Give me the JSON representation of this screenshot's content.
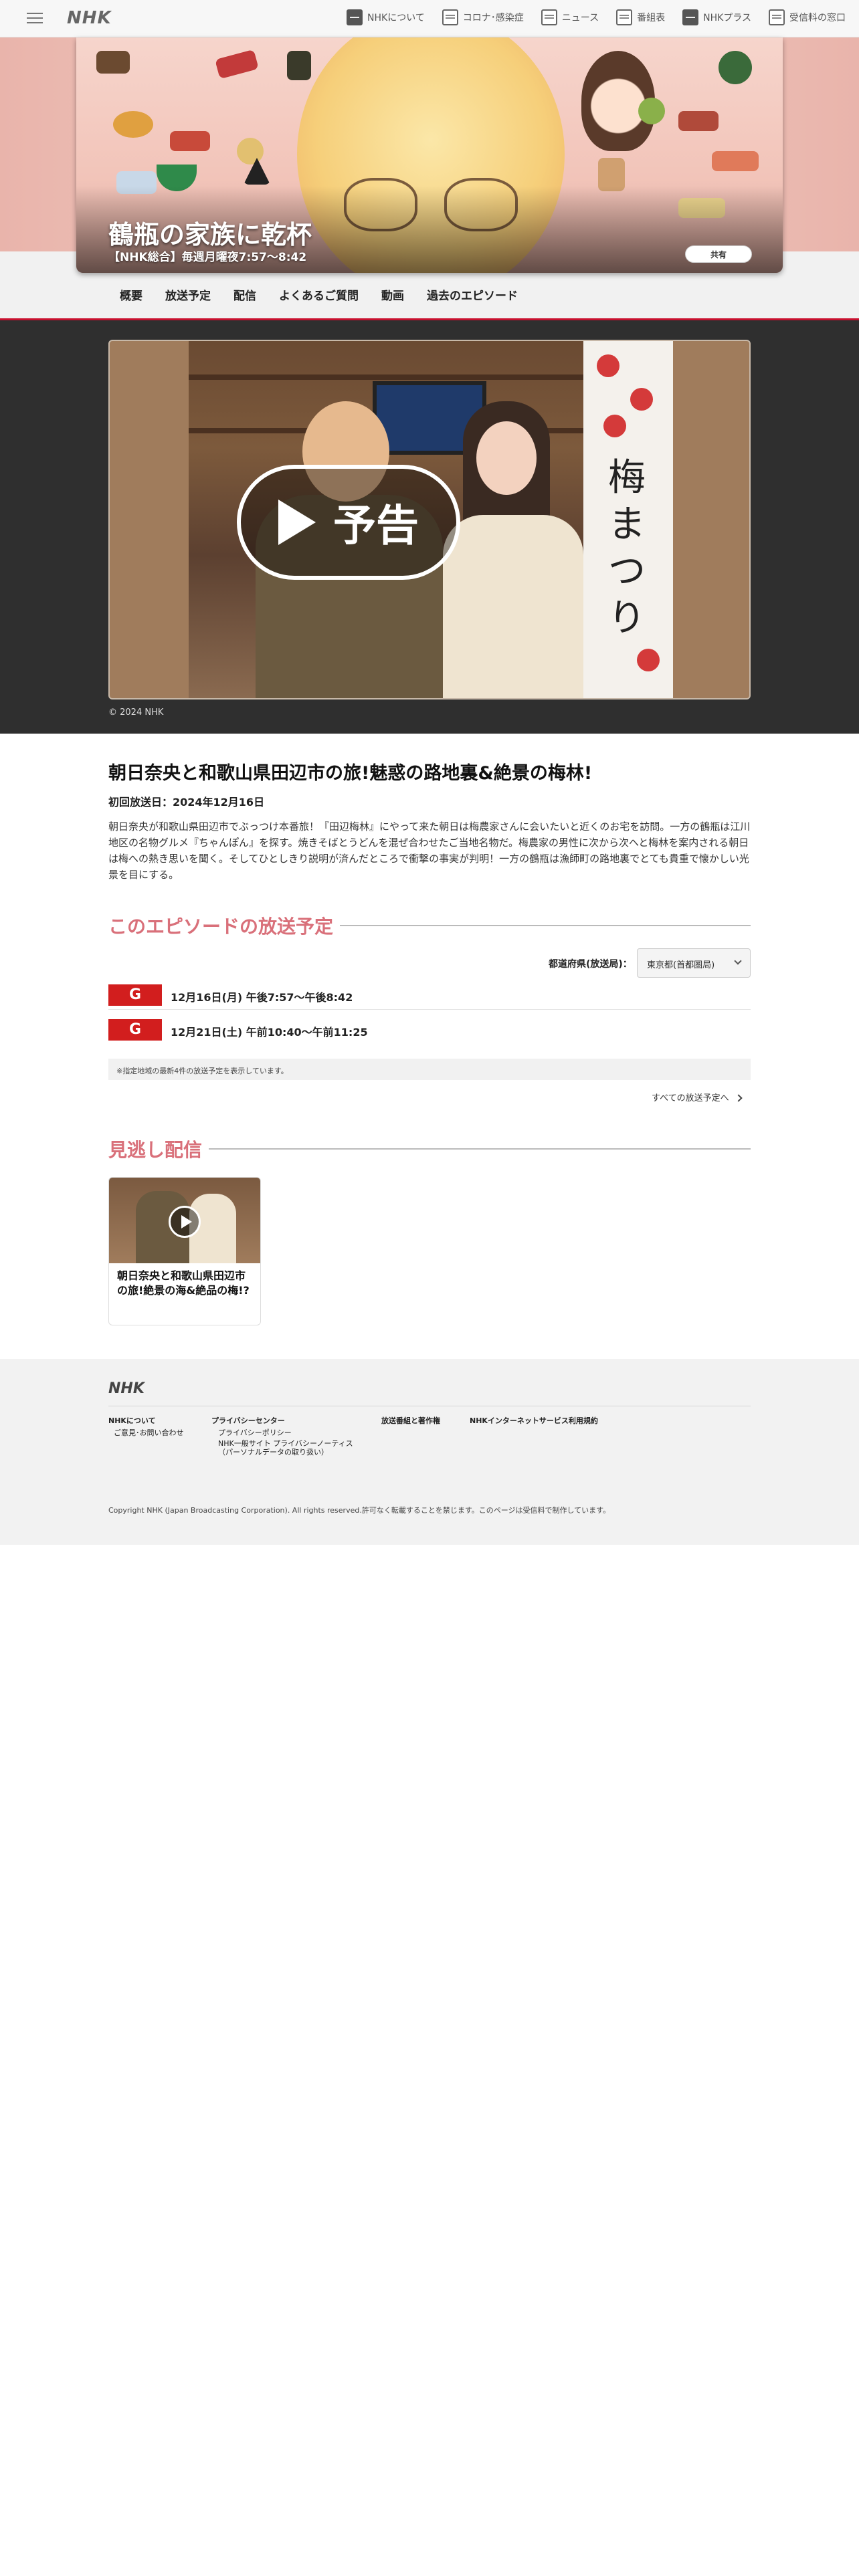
{
  "header": {
    "logo": "NHK",
    "nav": [
      {
        "label": "NHKについて",
        "icon": "nhk-about-icon"
      },
      {
        "label": "コロナ･感染症",
        "icon": "corona-icon"
      },
      {
        "label": "ニュース",
        "icon": "news-icon"
      },
      {
        "label": "番組表",
        "icon": "program-guide-icon"
      },
      {
        "label": "NHKプラス",
        "icon": "nhk-plus-icon"
      },
      {
        "label": "受信料の窓口",
        "icon": "fee-counter-icon"
      }
    ]
  },
  "program": {
    "title": "鶴瓶の家族に乾杯",
    "schedule": "【NHK総合】毎週月曜夜7:57〜8:42",
    "share_label": "共有"
  },
  "tabs": [
    "概要",
    "放送予定",
    "配信",
    "よくあるご質問",
    "動画",
    "過去のエピソード"
  ],
  "player": {
    "play_label": "予告",
    "banner_text": "梅まつり",
    "copyright": "© 2024 NHK"
  },
  "episode": {
    "title": "朝日奈央と和歌山県田辺市の旅!魅惑の路地裏&絶景の梅林!",
    "first_air": "初回放送日：2024年12月16日",
    "description": "朝日奈央が和歌山県田辺市でぶっつけ本番旅！『田辺梅林』にやって来た朝日は梅農家さんに会いたいと近くのお宅を訪問。一方の鶴瓶は江川地区の名物グルメ『ちゃんぽん』を探す。焼きそばとうどんを混ぜ合わせたご当地名物だ。梅農家の男性に次から次へと梅林を案内される朝日は梅への熱き思いを聞く。そしてひとしきり説明が済んだところで衝撃の事実が判明！一方の鶴瓶は漁師町の路地裏でとても貴重で懐かしい光景を目にする。"
  },
  "broadcast": {
    "heading": "このエピソードの放送予定",
    "pref_label": "都道府県(放送局)：",
    "pref_value": "東京都(首都圏局)",
    "schedules": [
      {
        "channel": "G",
        "time": "12月16日(月) 午後7:57〜午後8:42"
      },
      {
        "channel": "G",
        "time": "12月21日(土) 午前10:40〜午前11:25"
      }
    ],
    "notice": "※指定地域の最新4件の放送予定を表示しています。",
    "all_link": "すべての放送予定へ"
  },
  "vod": {
    "heading": "見逃し配信",
    "card_title": "朝日奈央と和歌山県田辺市の旅!絶景の海&絶品の梅!?"
  },
  "footer": {
    "logo": "NHK",
    "links": {
      "about": "NHKについて",
      "contact": "ご意見･お問い合わせ",
      "privacy_center": "プライバシーセンター",
      "privacy_policy": "プライバシーポリシー",
      "privacy_notice": "NHK一般サイト プライバシーノーティス（パーソナルデータの取り扱い）",
      "broadcast_rights": "放送番組と著作権",
      "terms": "NHKインターネットサービス利用規約"
    },
    "copyright": "Copyright NHK (Japan Broadcasting Corporation). All rights reserved.許可なく転載することを禁じます。このページは受信料で制作しています。"
  },
  "colors": {
    "accent_red": "#c8102e",
    "section_heading": "#d9707a",
    "channel_badge": "#d21e1e"
  }
}
